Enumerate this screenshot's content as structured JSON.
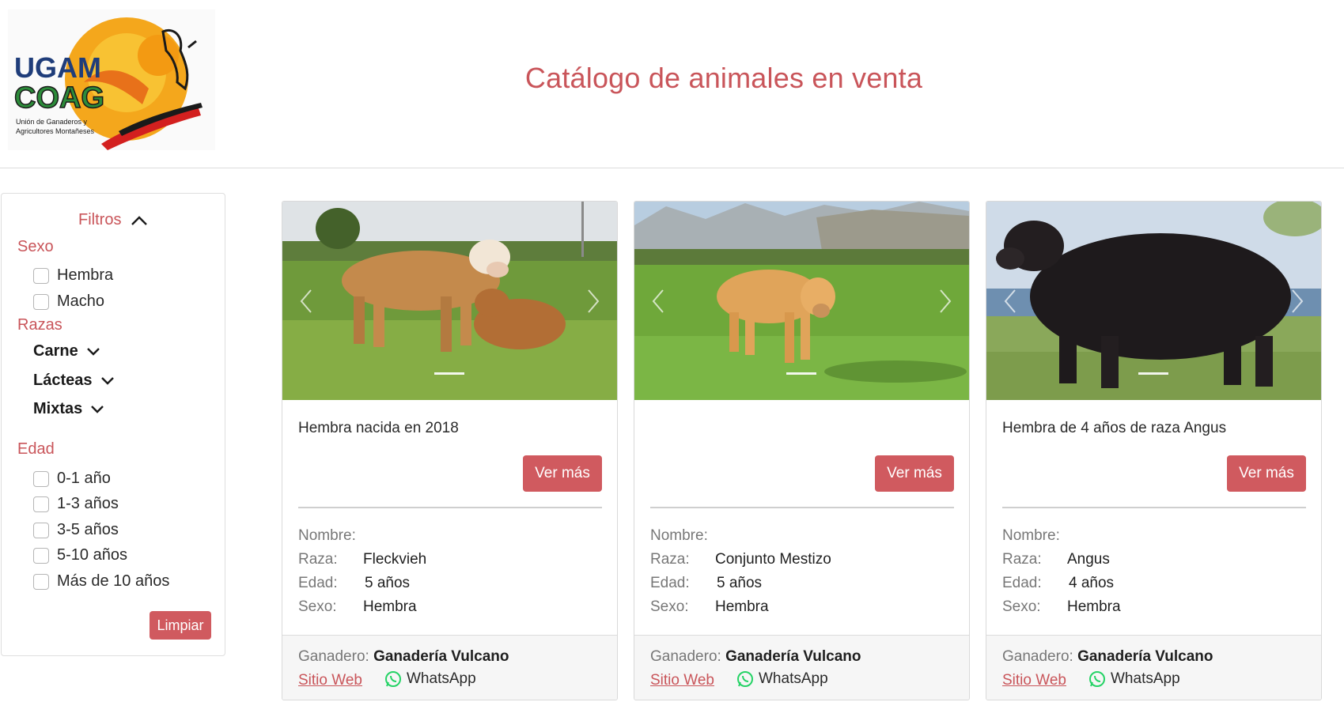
{
  "header": {
    "title": "Catálogo de animales en venta",
    "logo": {
      "line1": "UGAM",
      "line2": "COAG",
      "tagline1": "Unión de Ganaderos y",
      "tagline2": "Agricultores Montañeses"
    }
  },
  "filters": {
    "title": "Filtros",
    "sex_label": "Sexo",
    "sex_options": [
      "Hembra",
      "Macho"
    ],
    "breeds_label": "Razas",
    "breed_groups": [
      "Carne",
      "Lácteas",
      "Mixtas"
    ],
    "age_label": "Edad",
    "age_options": [
      "0-1 año",
      "1-3 años",
      "3-5 años",
      "5-10 años",
      "Más de 10 años"
    ],
    "clear_label": "Limpiar"
  },
  "cards": [
    {
      "description": "Hembra nacida en 2018",
      "more_label": "Ver más",
      "name_label": "Nombre:",
      "name_value": "",
      "breed_label": "Raza:",
      "breed_value": "Fleckvieh",
      "age_label": "Edad:",
      "age_value": "5 años",
      "sex_label": "Sexo:",
      "sex_value": "Hembra",
      "farmer_label": "Ganadero:",
      "farmer_value": "Ganadería Vulcano",
      "site_label": "Sitio Web",
      "whatsapp_label": "WhatsApp"
    },
    {
      "description": "",
      "more_label": "Ver más",
      "name_label": "Nombre:",
      "name_value": "",
      "breed_label": "Raza:",
      "breed_value": "Conjunto Mestizo",
      "age_label": "Edad:",
      "age_value": "5 años",
      "sex_label": "Sexo:",
      "sex_value": "Hembra",
      "farmer_label": "Ganadero:",
      "farmer_value": "Ganadería Vulcano",
      "site_label": "Sitio Web",
      "whatsapp_label": "WhatsApp"
    },
    {
      "description": "Hembra de 4 años de raza Angus",
      "more_label": "Ver más",
      "name_label": "Nombre:",
      "name_value": "",
      "breed_label": "Raza:",
      "breed_value": "Angus",
      "age_label": "Edad:",
      "age_value": "4 años",
      "sex_label": "Sexo:",
      "sex_value": "Hembra",
      "farmer_label": "Ganadero:",
      "farmer_value": "Ganadería Vulcano",
      "site_label": "Sitio Web",
      "whatsapp_label": "WhatsApp"
    }
  ],
  "colors": {
    "accent": "#d05a5f",
    "title": "#c9555a",
    "footer_bg": "#f6f6f6",
    "whatsapp": "#25d366"
  }
}
